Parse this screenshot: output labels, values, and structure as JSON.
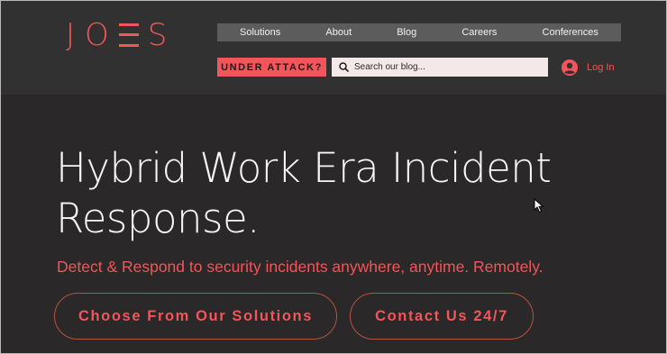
{
  "brand": {
    "logo_text": "JOES"
  },
  "nav": {
    "items": [
      "Solutions",
      "About",
      "Blog",
      "Careers",
      "Conferences"
    ]
  },
  "header": {
    "attack_label": "UNDER ATTACK?",
    "search_placeholder": "Search our blog...",
    "login_label": "Log In"
  },
  "hero": {
    "title_line1": "Hybrid Work Era Incident",
    "title_line2": "Response.",
    "subtitle": "Detect & Respond to security incidents anywhere, anytime. Remotely.",
    "primary_button": "Choose From Our Solutions",
    "secondary_button": "Contact Us 24/7"
  },
  "colors": {
    "accent": "#f2555a",
    "background": "#2a2828",
    "header_background": "#323131",
    "nav_background": "#5d5c5c",
    "search_background": "#f5e8e9"
  },
  "icons": [
    "search-icon",
    "user-avatar-icon",
    "mouse-cursor-icon"
  ]
}
